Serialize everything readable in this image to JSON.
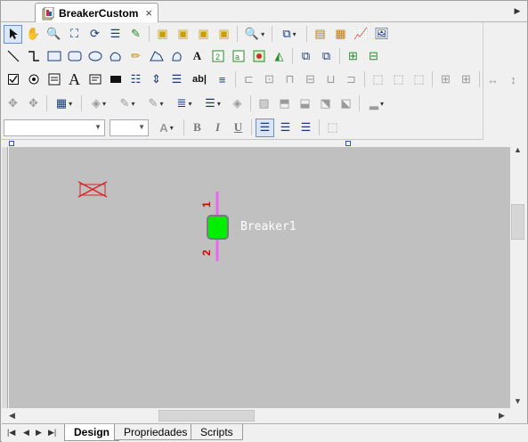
{
  "document_tab": {
    "title": "BreakerCustom",
    "close_glyph": "×"
  },
  "tabstrip": {
    "nav_left": "◀",
    "nav_right": "▶"
  },
  "toolbar": {
    "row1": [
      "pointer-tool-icon",
      "pan-tool-icon",
      "zoom-tool-icon",
      "zoom-fit-icon",
      "rotate-icon",
      "align-icon",
      "delete-link-icon",
      "group1-icon",
      "group2-icon",
      "group3-icon",
      "group4-icon",
      "zoom-menu-icon",
      "order-menu-icon",
      "window-icon",
      "panel-icon",
      "chart-icon",
      "picture-icon"
    ],
    "row2": [
      "line-tool-icon",
      "connector-tool-icon",
      "rectangle-tool-icon",
      "rounded-rect-tool-icon",
      "ellipse-tool-icon",
      "polygon-tool-icon",
      "pencil-tool-icon",
      "bezier-tool-icon",
      "fill-shape-icon",
      "text-tool-icon",
      "numeric-field-icon",
      "label-field-icon",
      "image-tool-icon",
      "flip-icon",
      "bring-front-icon",
      "send-back-icon",
      "move-icon"
    ],
    "row3": [
      "checkbox-tool-icon",
      "radio-tool-icon",
      "list-tool-icon",
      "textbox-tool-icon",
      "button-tool-icon",
      "listbox-tool-icon",
      "spin-tool-icon",
      "combo-tool-icon",
      "editbox-tool-icon",
      "table-tool-icon"
    ],
    "row3_glyphs": {
      "text": "A",
      "editbox": "ab|"
    },
    "font_combo": {
      "value": ""
    },
    "size_combo": {
      "value": ""
    },
    "format": {
      "bold": "B",
      "italic": "I",
      "underline": "U"
    }
  },
  "canvas": {
    "component_label": "Breaker1",
    "pin1_label": "1",
    "pin2_label": "2",
    "colors": {
      "background": "#c0c0c0",
      "breaker_body": "#00ee00",
      "lead": "#ee66ee",
      "pin_label": "#dd0000",
      "error_x": "#dd2222"
    }
  },
  "bottom_tabs": [
    {
      "label": "Design",
      "active": true
    },
    {
      "label": "Propriedades",
      "active": false
    },
    {
      "label": "Scripts",
      "active": false
    }
  ],
  "bottom_nav": {
    "first": "|◀",
    "prev": "◀",
    "next": "▶",
    "last": "▶|"
  }
}
